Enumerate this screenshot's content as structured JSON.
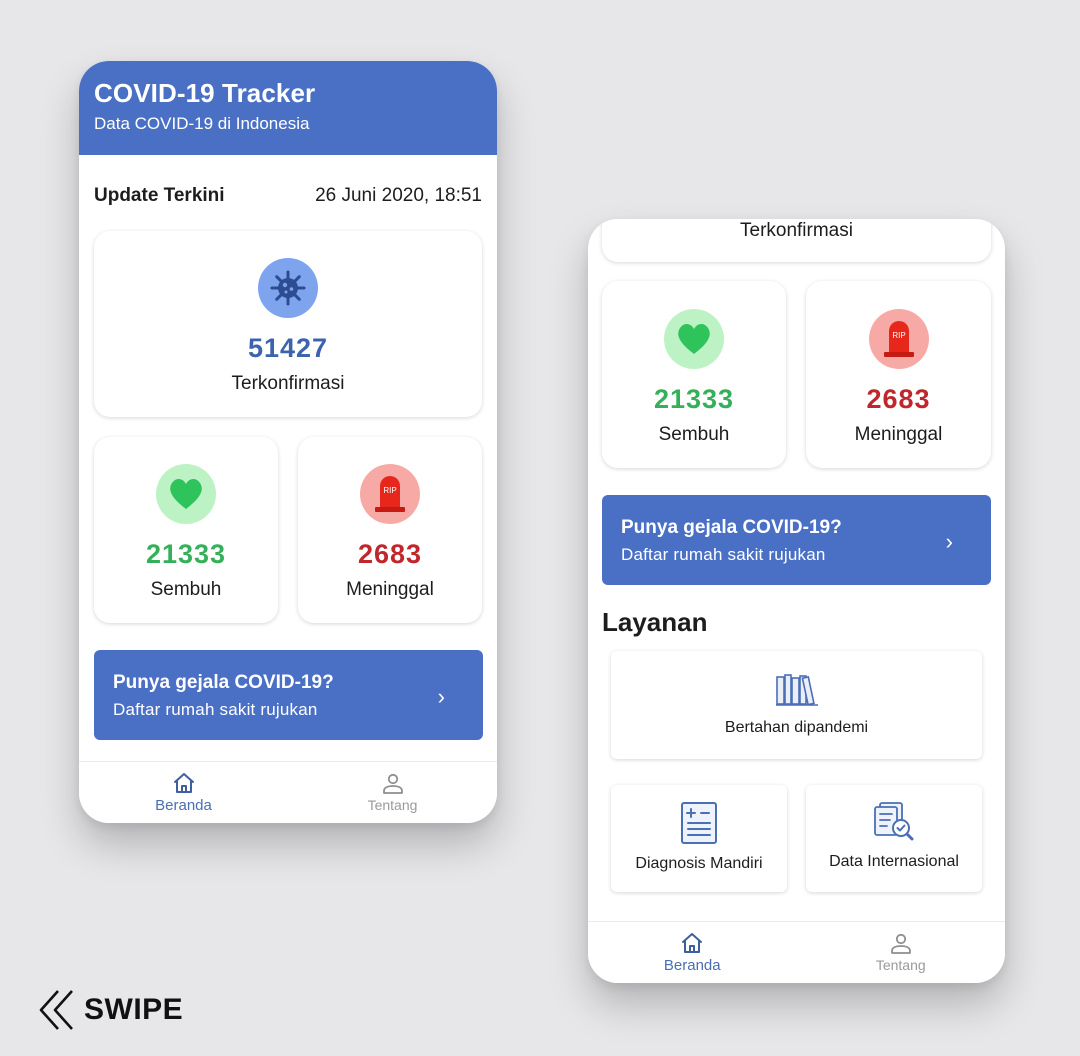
{
  "screen1": {
    "header": {
      "title": "COVID-19 Tracker",
      "subtitle": "Data COVID-19 di Indonesia"
    },
    "update": {
      "label": "Update Terkini",
      "datetime": "26 Juni 2020, 18:51"
    },
    "stats": {
      "confirmed": {
        "value": "51427",
        "label": "Terkonfirmasi",
        "icon": "virus-icon",
        "color": "#3c63ac"
      },
      "recovered": {
        "value": "21333",
        "label": "Sembuh",
        "icon": "heart-icon",
        "color": "#34b05a"
      },
      "deaths": {
        "value": "2683",
        "label": "Meninggal",
        "icon": "tombstone-icon",
        "color": "#c0272d",
        "icon_text": "RIP"
      }
    },
    "cta": {
      "title": "Punya gejala COVID-19?",
      "subtitle": "Daftar rumah sakit rujukan",
      "arrow": "›"
    },
    "nav": [
      {
        "label": "Beranda",
        "icon": "home-icon",
        "active": true
      },
      {
        "label": "Tentang",
        "icon": "person-icon",
        "active": false
      }
    ]
  },
  "screen2": {
    "partial_card_label": "Terkonfirmasi",
    "stats": {
      "recovered": {
        "value": "21333",
        "label": "Sembuh"
      },
      "deaths": {
        "value": "2683",
        "label": "Meninggal",
        "icon_text": "RIP"
      }
    },
    "cta": {
      "title": "Punya gejala COVID-19?",
      "subtitle": "Daftar rumah sakit rujukan",
      "arrow": "›"
    },
    "section_title": "Layanan",
    "services": [
      {
        "label": "Bertahan dipandemi",
        "icon": "books-icon"
      },
      {
        "label": "Diagnosis Mandiri",
        "icon": "clipboard-icon"
      },
      {
        "label": "Data Internasional",
        "icon": "search-report-icon"
      }
    ],
    "nav": [
      {
        "label": "Beranda",
        "icon": "home-icon",
        "active": true
      },
      {
        "label": "Tentang",
        "icon": "person-icon",
        "active": false
      }
    ]
  },
  "swipe": {
    "label": "SWIPE",
    "icon": "double-chevron-left-icon"
  },
  "colors": {
    "primary": "#4a70c6",
    "confirmed": "#3c63ac",
    "recovered": "#34b05a",
    "deaths": "#c0272d",
    "background": "#e7e7e9"
  }
}
